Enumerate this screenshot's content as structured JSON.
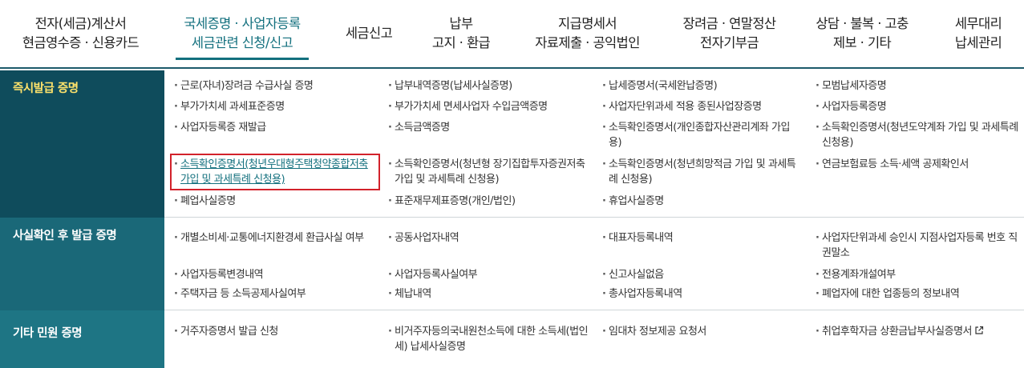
{
  "nav": {
    "items": [
      {
        "line1": "전자(세금)계산서",
        "line2": "현금영수증 · 신용카드"
      },
      {
        "line1": "국세증명 · 사업자등록",
        "line2": "세금관련 신청/신고"
      },
      {
        "line1": "세금신고",
        "line2": ""
      },
      {
        "line1": "납부",
        "line2": "고지 · 환급"
      },
      {
        "line1": "지급명세서",
        "line2": "자료제출 · 공익법인"
      },
      {
        "line1": "장려금 · 연말정산",
        "line2": "전자기부금"
      },
      {
        "line1": "상담 · 불복 · 고충",
        "line2": "제보 · 기타"
      },
      {
        "line1": "세무대리",
        "line2": "납세관리"
      }
    ],
    "active_index": 1
  },
  "colors": {
    "row1_bg": "#0f4c5c",
    "row2_bg": "#1a6878",
    "row3_bg": "#1e7584",
    "accent": "#13707e",
    "highlight_border": "#d2222b"
  },
  "sections": [
    {
      "label": "즉시발급 증명",
      "rows": [
        [
          "근로(자녀)장려금 수급사실 증명",
          "납부내역증명(납세사실증명)",
          "납세증명서(국세완납증명)",
          "모범납세자증명"
        ],
        [
          "부가가치세 과세표준증명",
          "부가가치세 면세사업자 수입금액증명",
          "사업자단위과세 적용 종된사업장증명",
          "사업자등록증명"
        ],
        [
          "사업자등록증 재발급",
          "소득금액증명",
          "소득확인증명서(개인종합자산관리계좌 가입용)",
          "소득확인증명서(청년도약계좌 가입 및 과세특례 신청용)"
        ],
        [
          "소득확인증명서(청년우대형주택청약종합저축 가입 및 과세특례 신청용)",
          "소득확인증명서(청년형 장기집합투자증권저축 가입 및 과세특례 신청용)",
          "소득확인증명서(청년희망적금 가입 및 과세특례 신청용)",
          "연금보험료등 소득·세액 공제확인서"
        ],
        [
          "폐업사실증명",
          "표준재무제표증명(개인/법인)",
          "휴업사실증명",
          ""
        ]
      ]
    },
    {
      "label": "사실확인 후 발급 증명",
      "rows": [
        [
          "개별소비세·교통에너지환경세 환급사실 여부",
          "공동사업자내역",
          "대표자등록내역",
          "사업자단위과세 승인시 지점사업자등록 번호 직권말소"
        ],
        [
          "사업자등록변경내역",
          "사업자등록사실여부",
          "신고사실없음",
          "전용계좌개설여부"
        ],
        [
          "주택자금 등 소득공제사실여부",
          "체납내역",
          "총사업자등록내역",
          "폐업자에 대한 업종등의 정보내역"
        ]
      ]
    },
    {
      "label": "기타 민원 증명",
      "rows": [
        [
          "거주자증명서 발급 신청",
          "비거주자등의국내원천소득에 대한 소득세(법인세) 납세사실증명",
          "임대차 정보제공 요청서",
          "취업후학자금 상환금납부사실증명서"
        ]
      ]
    }
  ],
  "icons": {
    "external_link": "external-link-icon"
  }
}
